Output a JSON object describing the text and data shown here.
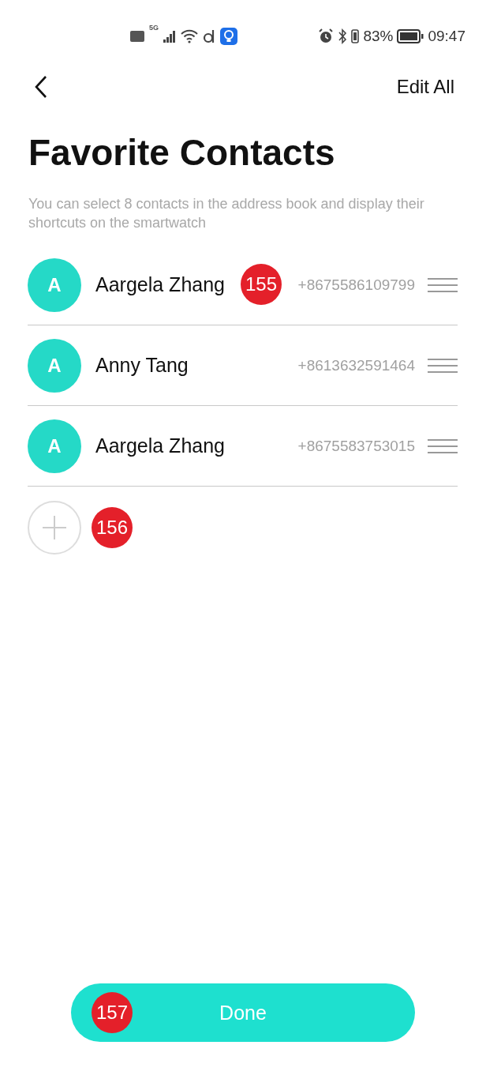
{
  "status_bar": {
    "network": "5G",
    "battery_percent": "83%",
    "time": "09:47"
  },
  "header": {
    "action": "Edit All"
  },
  "title": "Favorite Contacts",
  "description": "You can select 8 contacts in the address book and display their shortcuts on the smartwatch",
  "contacts": [
    {
      "initial": "A",
      "name": "Aargela Zhang",
      "phone": "+8675586109799",
      "marker": "155"
    },
    {
      "initial": "A",
      "name": "Anny Tang",
      "phone": "+8613632591464"
    },
    {
      "initial": "A",
      "name": "Aargela Zhang",
      "phone": "+8675583753015"
    }
  ],
  "add": {
    "marker": "156"
  },
  "done": {
    "label": "Done",
    "marker": "157"
  }
}
